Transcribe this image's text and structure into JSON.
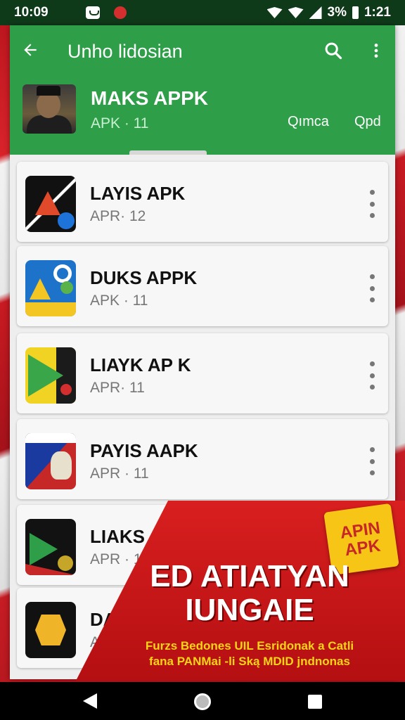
{
  "status_bar": {
    "time": "10:09",
    "battery": "3%",
    "clock": "1:21"
  },
  "toolbar": {
    "title": "Unho lidosian",
    "back_icon": "arrow-back-icon",
    "search_icon": "search-icon",
    "more_icon": "more-vert-icon"
  },
  "featured": {
    "title": "MAKS APPK",
    "subtitle": "APK · 11",
    "action_1": "Qımca",
    "action_2": "Qpd"
  },
  "list": {
    "items": [
      {
        "title": "LAYIS APK",
        "subtitle": "APR· 12"
      },
      {
        "title": "DUKS APPK",
        "subtitle": "APK · 11"
      },
      {
        "title": "LIAYK AP K",
        "subtitle": "APR· 11"
      },
      {
        "title": "PAYIS AAPK",
        "subtitle": "APR · 11"
      },
      {
        "title": "LIAKS AP",
        "subtitle": "APR · 12"
      },
      {
        "title": "DA",
        "subtitle": "A"
      }
    ]
  },
  "promo": {
    "badge_line_1": "APIN",
    "badge_line_2": "APK",
    "headline_1": "ED ATIATYAN",
    "headline_2": "IUNGAIE",
    "fine_1": "Furzs Bedones UIL Esridonak a Catli",
    "fine_2": "fana PANMai -li Ską MDID jndnonas"
  },
  "colors": {
    "header_green": "#2e9e48",
    "promo_red": "#d91f1f",
    "badge_yellow": "#f7c516"
  }
}
